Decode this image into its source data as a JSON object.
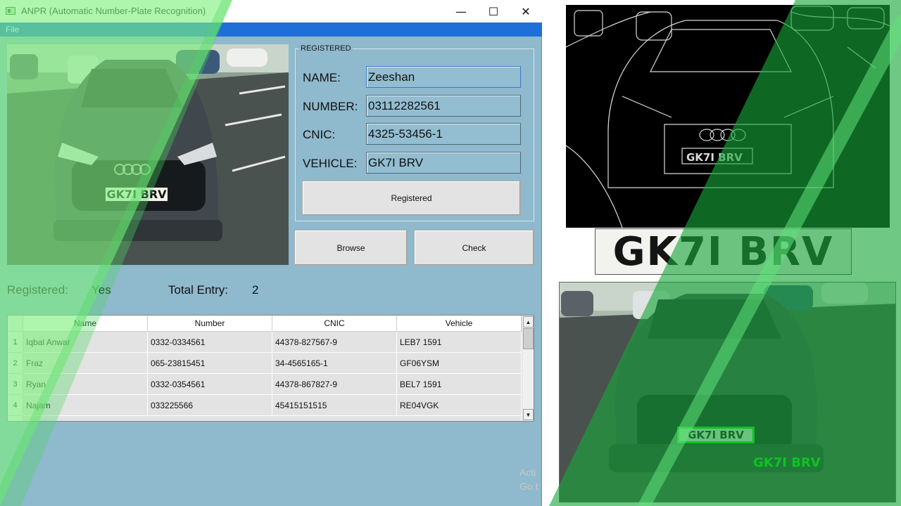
{
  "window": {
    "title": "ANPR (Automatic Number-Plate Recognition)",
    "minimize_glyph": "—",
    "maximize_glyph": "☐",
    "close_glyph": "✕"
  },
  "menu": {
    "file_label": "File"
  },
  "photo": {
    "plate_text": "GK7I BRV"
  },
  "registered_group": {
    "title": "REGISTERED",
    "fields": [
      {
        "label": "NAME:",
        "value": "Zeeshan"
      },
      {
        "label": "NUMBER:",
        "value": "03112282561"
      },
      {
        "label": "CNIC:",
        "value": "4325-53456-1"
      },
      {
        "label": "VEHICLE:",
        "value": "GK7I BRV"
      }
    ],
    "button_label": "Registered"
  },
  "buttons": {
    "browse_label": "Browse",
    "check_label": "Check"
  },
  "status": {
    "registered_label": "Registered:",
    "registered_value": "Yes",
    "total_label": "Total Entry:",
    "total_value": "2"
  },
  "table": {
    "columns": [
      "Name",
      "Number",
      "CNIC",
      "Vehicle"
    ],
    "rows": [
      {
        "index": "1",
        "cells": [
          "Iqbal Anwar",
          "0332-0334561",
          "44378-827567-9",
          "LEB7 1591"
        ]
      },
      {
        "index": "2",
        "cells": [
          "Fraz",
          "065-23815451",
          "34-4565165-1",
          "GF06YSM"
        ]
      },
      {
        "index": "3",
        "cells": [
          "Ryan",
          "0332-0354561",
          "44378-867827-9",
          "BEL7 1591"
        ]
      },
      {
        "index": "4",
        "cells": [
          "Najam",
          "033225566",
          "45415151515",
          "RE04VGK"
        ]
      }
    ]
  },
  "edge_image": {
    "plate_text": "GK7I BRV"
  },
  "plate_crop": {
    "text": "GK7I BRV"
  },
  "detected": {
    "plate_text": "GK7I BRV",
    "label_text": "GK7I BRV"
  },
  "watermark": {
    "line1": "Acti",
    "line2": "Go t"
  },
  "colors": {
    "window_bg": "#8fb9cc",
    "menubar": "#1f6fd8",
    "overlay_light": "#7cf07c",
    "overlay_dark": "#19a63a",
    "detection": "#00ee00"
  }
}
